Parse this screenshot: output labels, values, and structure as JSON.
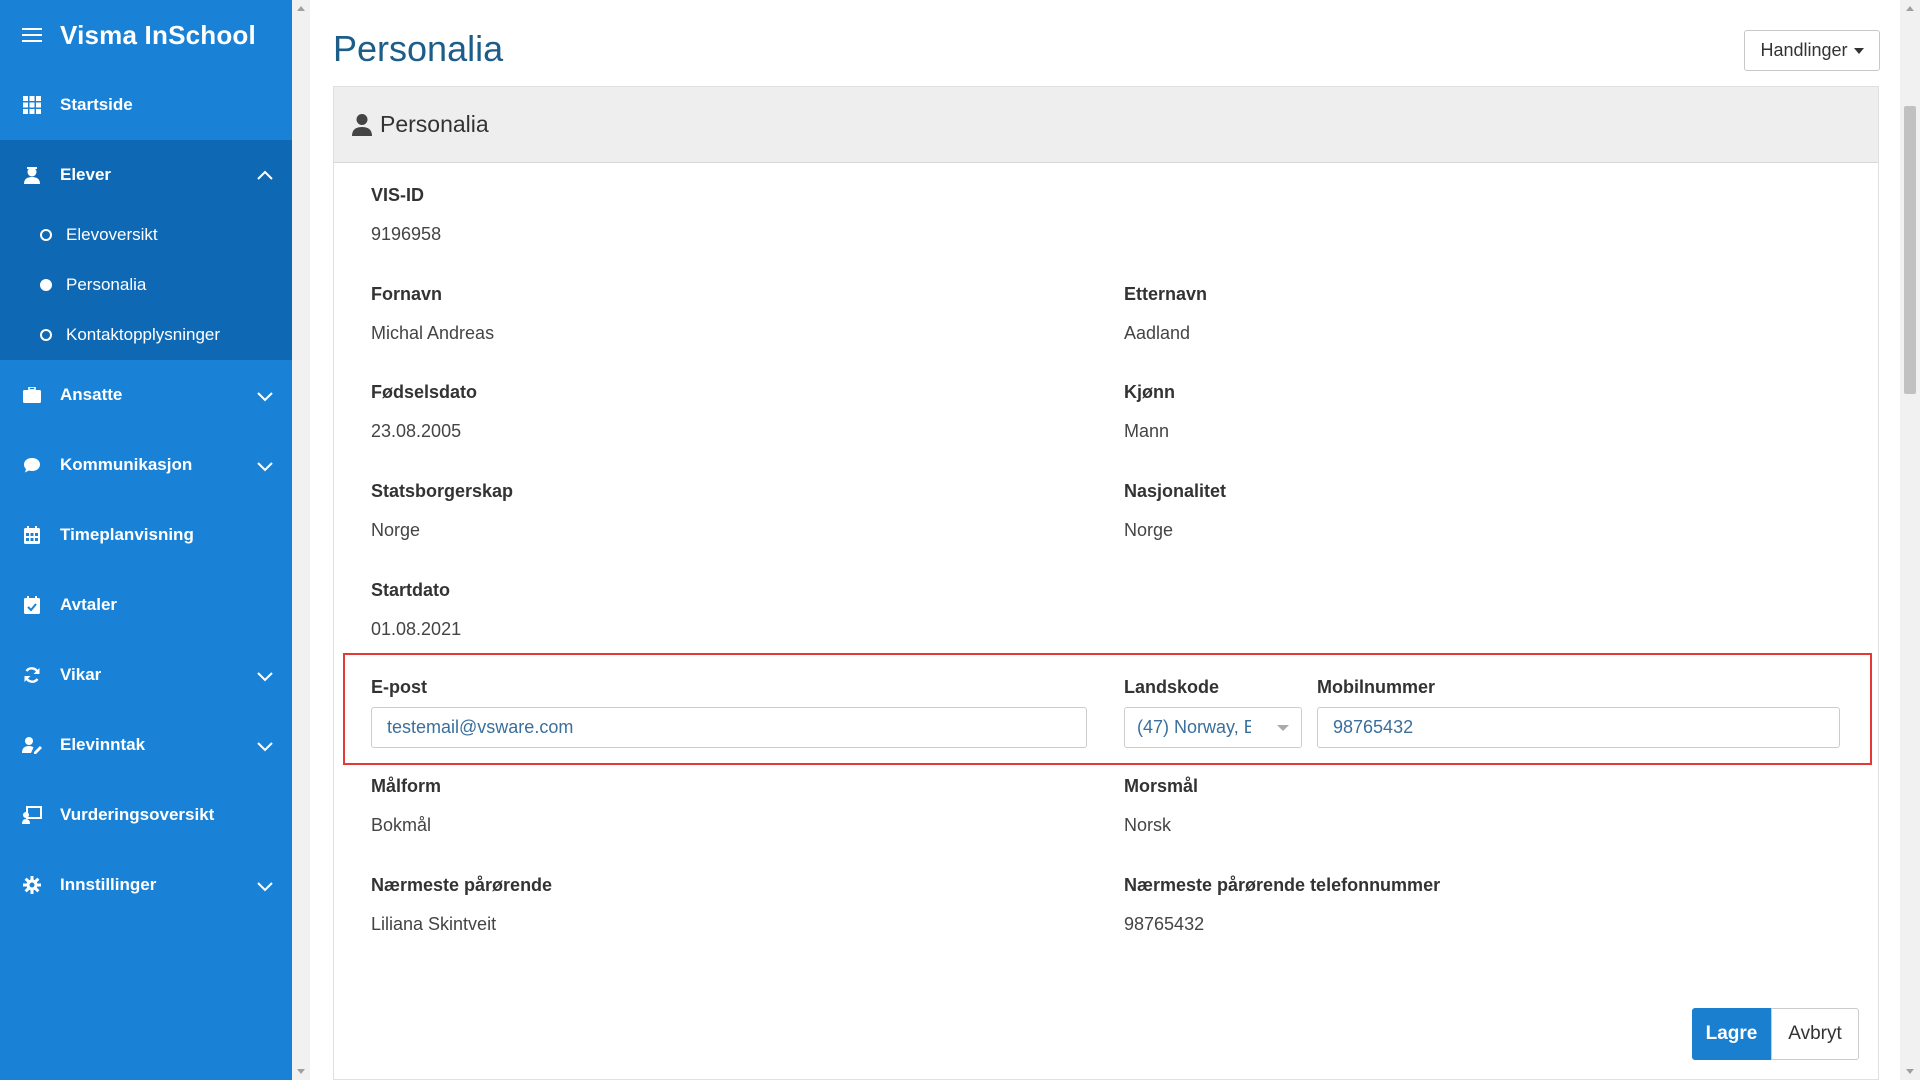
{
  "app": {
    "title": "Visma InSchool"
  },
  "sidebar": {
    "items": [
      {
        "label": "Startside"
      },
      {
        "label": "Elever"
      },
      {
        "label": "Ansatte"
      },
      {
        "label": "Kommunikasjon"
      },
      {
        "label": "Timeplanvisning"
      },
      {
        "label": "Avtaler"
      },
      {
        "label": "Vikar"
      },
      {
        "label": "Elevinntak"
      },
      {
        "label": "Vurderingsoversikt"
      },
      {
        "label": "Innstillinger"
      }
    ],
    "elever_sub": [
      {
        "label": "Elevoversikt",
        "active": false
      },
      {
        "label": "Personalia",
        "active": true
      },
      {
        "label": "Kontaktopplysninger",
        "active": false
      }
    ]
  },
  "page": {
    "title": "Personalia",
    "actions_label": "Handlinger",
    "card_title": "Personalia"
  },
  "fields": {
    "visid": {
      "label": "VIS-ID",
      "value": "9196958"
    },
    "fornavn": {
      "label": "Fornavn",
      "value": "Michal Andreas"
    },
    "etternavn": {
      "label": "Etternavn",
      "value": "Aadland"
    },
    "fodselsdato": {
      "label": "Fødselsdato",
      "value": "23.08.2005"
    },
    "kjonn": {
      "label": "Kjønn",
      "value": "Mann"
    },
    "statsborgerskap": {
      "label": "Statsborgerskap",
      "value": "Norge"
    },
    "nasjonalitet": {
      "label": "Nasjonalitet",
      "value": "Norge"
    },
    "startdato": {
      "label": "Startdato",
      "value": "01.08.2021"
    },
    "epost": {
      "label": "E-post",
      "value": "testemail@vsware.com"
    },
    "landskode": {
      "label": "Landskode",
      "value": "(47) Norway, E"
    },
    "mobilnummer": {
      "label": "Mobilnummer",
      "value": "98765432"
    },
    "malform": {
      "label": "Målform",
      "value": "Bokmål"
    },
    "morsmal": {
      "label": "Morsmål",
      "value": "Norsk"
    },
    "parorende": {
      "label": "Nærmeste pårørende",
      "value": "Liliana Skintveit"
    },
    "parorende_tlf": {
      "label": "Nærmeste pårørende telefonnummer",
      "value": "98765432"
    }
  },
  "buttons": {
    "save": "Lagre",
    "cancel": "Avbryt"
  },
  "colors": {
    "sidebar": "#1a82d6",
    "sidebar_active_group": "#0f68b3",
    "title": "#1c5d8a",
    "highlight": "#e53935",
    "primary": "#1a7fcf"
  }
}
